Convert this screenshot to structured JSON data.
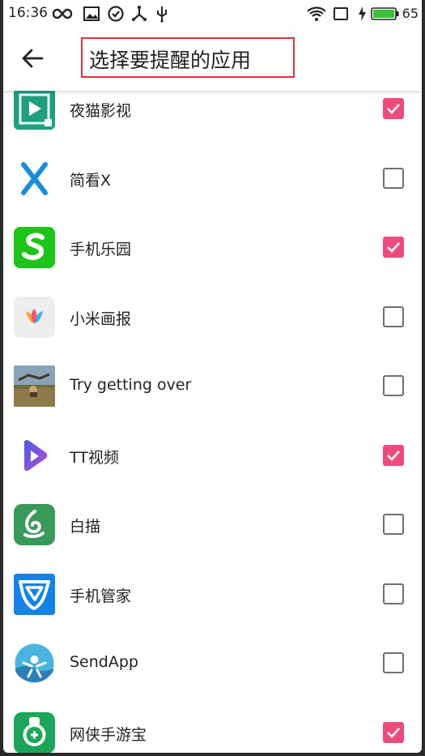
{
  "status_bar": {
    "time": "16:36",
    "battery_level": "65",
    "icons": [
      "infinity-icon",
      "image-icon",
      "check-circle-icon",
      "usb-icon",
      "usb-tether-icon",
      "wifi-icon",
      "screen-icon",
      "charging-bolt-icon",
      "battery-icon"
    ]
  },
  "app_bar": {
    "title": "选择要提醒的应用",
    "back_icon": "arrow-left-icon"
  },
  "colors": {
    "checked": "#ef4a7e",
    "unchecked_border": "#6f6f6f",
    "highlight_box": "#d9343b"
  },
  "apps": [
    {
      "name": "夜猫影视",
      "icon": "play-tile-icon",
      "checked": true
    },
    {
      "name": "简看X",
      "icon": "x-letter-icon",
      "checked": false
    },
    {
      "name": "手机乐园",
      "icon": "s-letter-icon",
      "checked": true
    },
    {
      "name": "小米画报",
      "icon": "tulip-icon",
      "checked": false
    },
    {
      "name": "Try getting over",
      "icon": "game-scene-icon",
      "checked": false
    },
    {
      "name": "TT视频",
      "icon": "gradient-play-icon",
      "checked": true
    },
    {
      "name": "白描",
      "icon": "swirl-icon",
      "checked": false
    },
    {
      "name": "手机管家",
      "icon": "shield-icon",
      "checked": false
    },
    {
      "name": "SendApp",
      "icon": "send-figure-icon",
      "checked": false
    },
    {
      "name": "网侠手游宝",
      "icon": "gamepad-badge-icon",
      "checked": true
    }
  ]
}
